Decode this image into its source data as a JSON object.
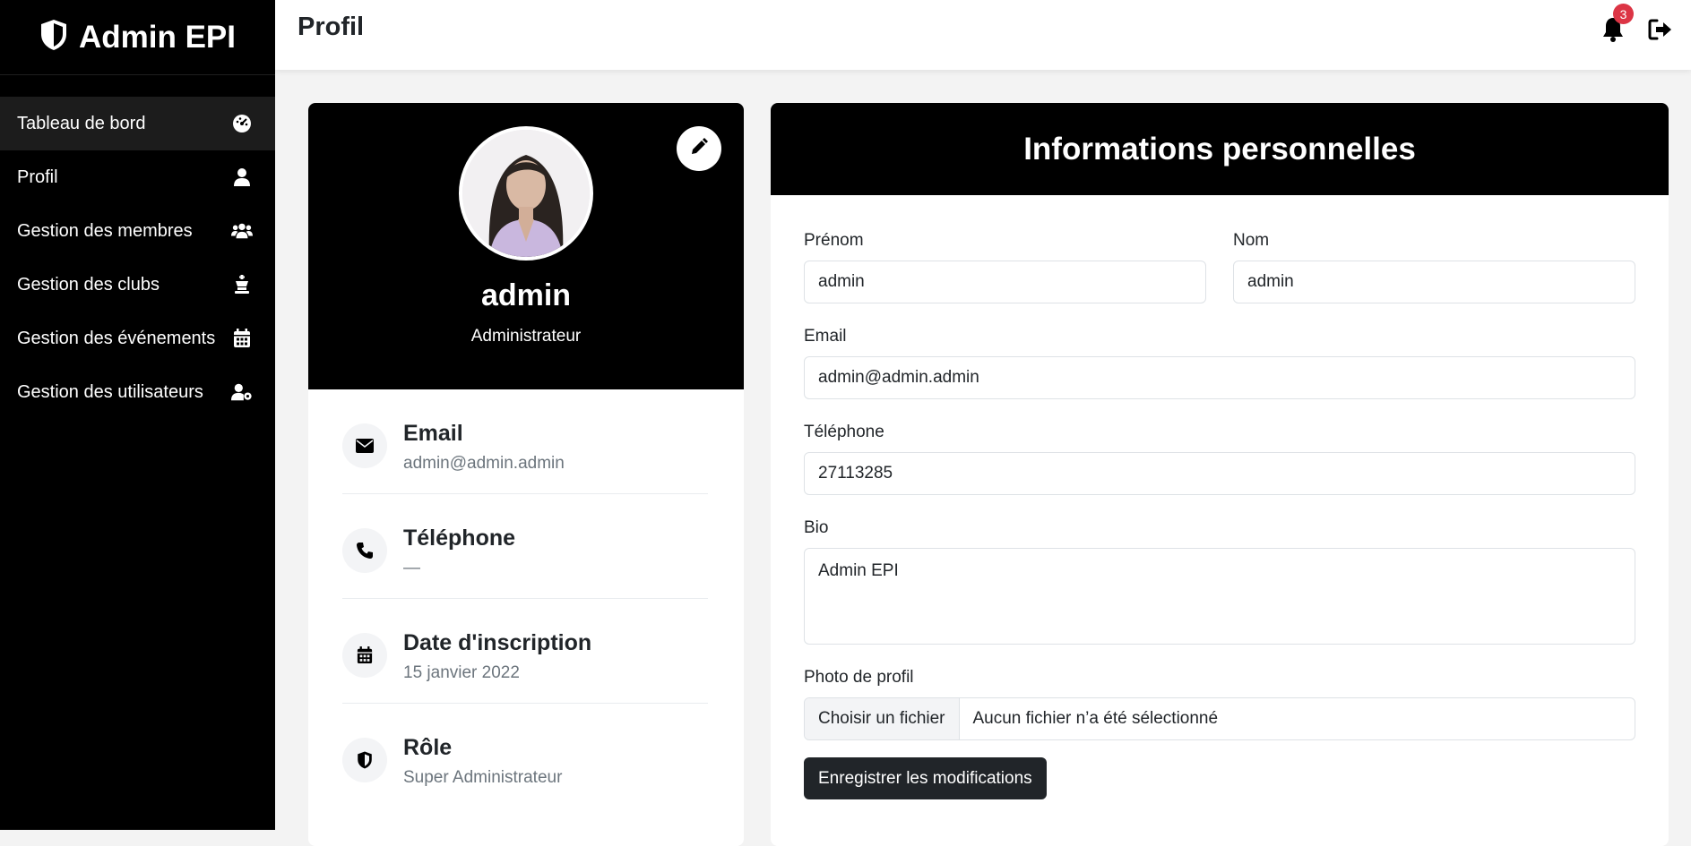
{
  "sidebar": {
    "brand": "Admin EPI",
    "items": [
      {
        "label": "Tableau de bord",
        "icon": "gauge-icon"
      },
      {
        "label": "Profil",
        "icon": "user-icon"
      },
      {
        "label": "Gestion des membres",
        "icon": "users-icon"
      },
      {
        "label": "Gestion des clubs",
        "icon": "chess-icon"
      },
      {
        "label": "Gestion des événements",
        "icon": "calendar-icon"
      },
      {
        "label": "Gestion des utilisateurs",
        "icon": "user-gear-icon"
      }
    ]
  },
  "topbar": {
    "title": "Profil",
    "notification_count": "3"
  },
  "profile": {
    "name": "admin",
    "role": "Administrateur",
    "info": [
      {
        "label": "Email",
        "value": "admin@admin.admin",
        "icon": "envelope-icon"
      },
      {
        "label": "Téléphone",
        "value": "—",
        "icon": "phone-icon"
      },
      {
        "label": "Date d'inscription",
        "value": "15 janvier 2022",
        "icon": "calendar-icon"
      },
      {
        "label": "Rôle",
        "value": "Super Administrateur",
        "icon": "shield-icon"
      }
    ]
  },
  "form": {
    "title": "Informations personnelles",
    "prenom_label": "Prénom",
    "prenom_value": "admin",
    "nom_label": "Nom",
    "nom_value": "admin",
    "email_label": "Email",
    "email_value": "admin@admin.admin",
    "tel_label": "Téléphone",
    "tel_value": "27113285",
    "bio_label": "Bio",
    "bio_value": "Admin EPI",
    "photo_label": "Photo de profil",
    "file_button": "Choisir un fichier",
    "file_status": "Aucun fichier n’a été sélectionné",
    "submit_label": "Enregistrer les modifications"
  },
  "colors": {
    "sidebar_bg": "#000000",
    "badge": "#dc3545",
    "submit_bg": "#212529"
  }
}
